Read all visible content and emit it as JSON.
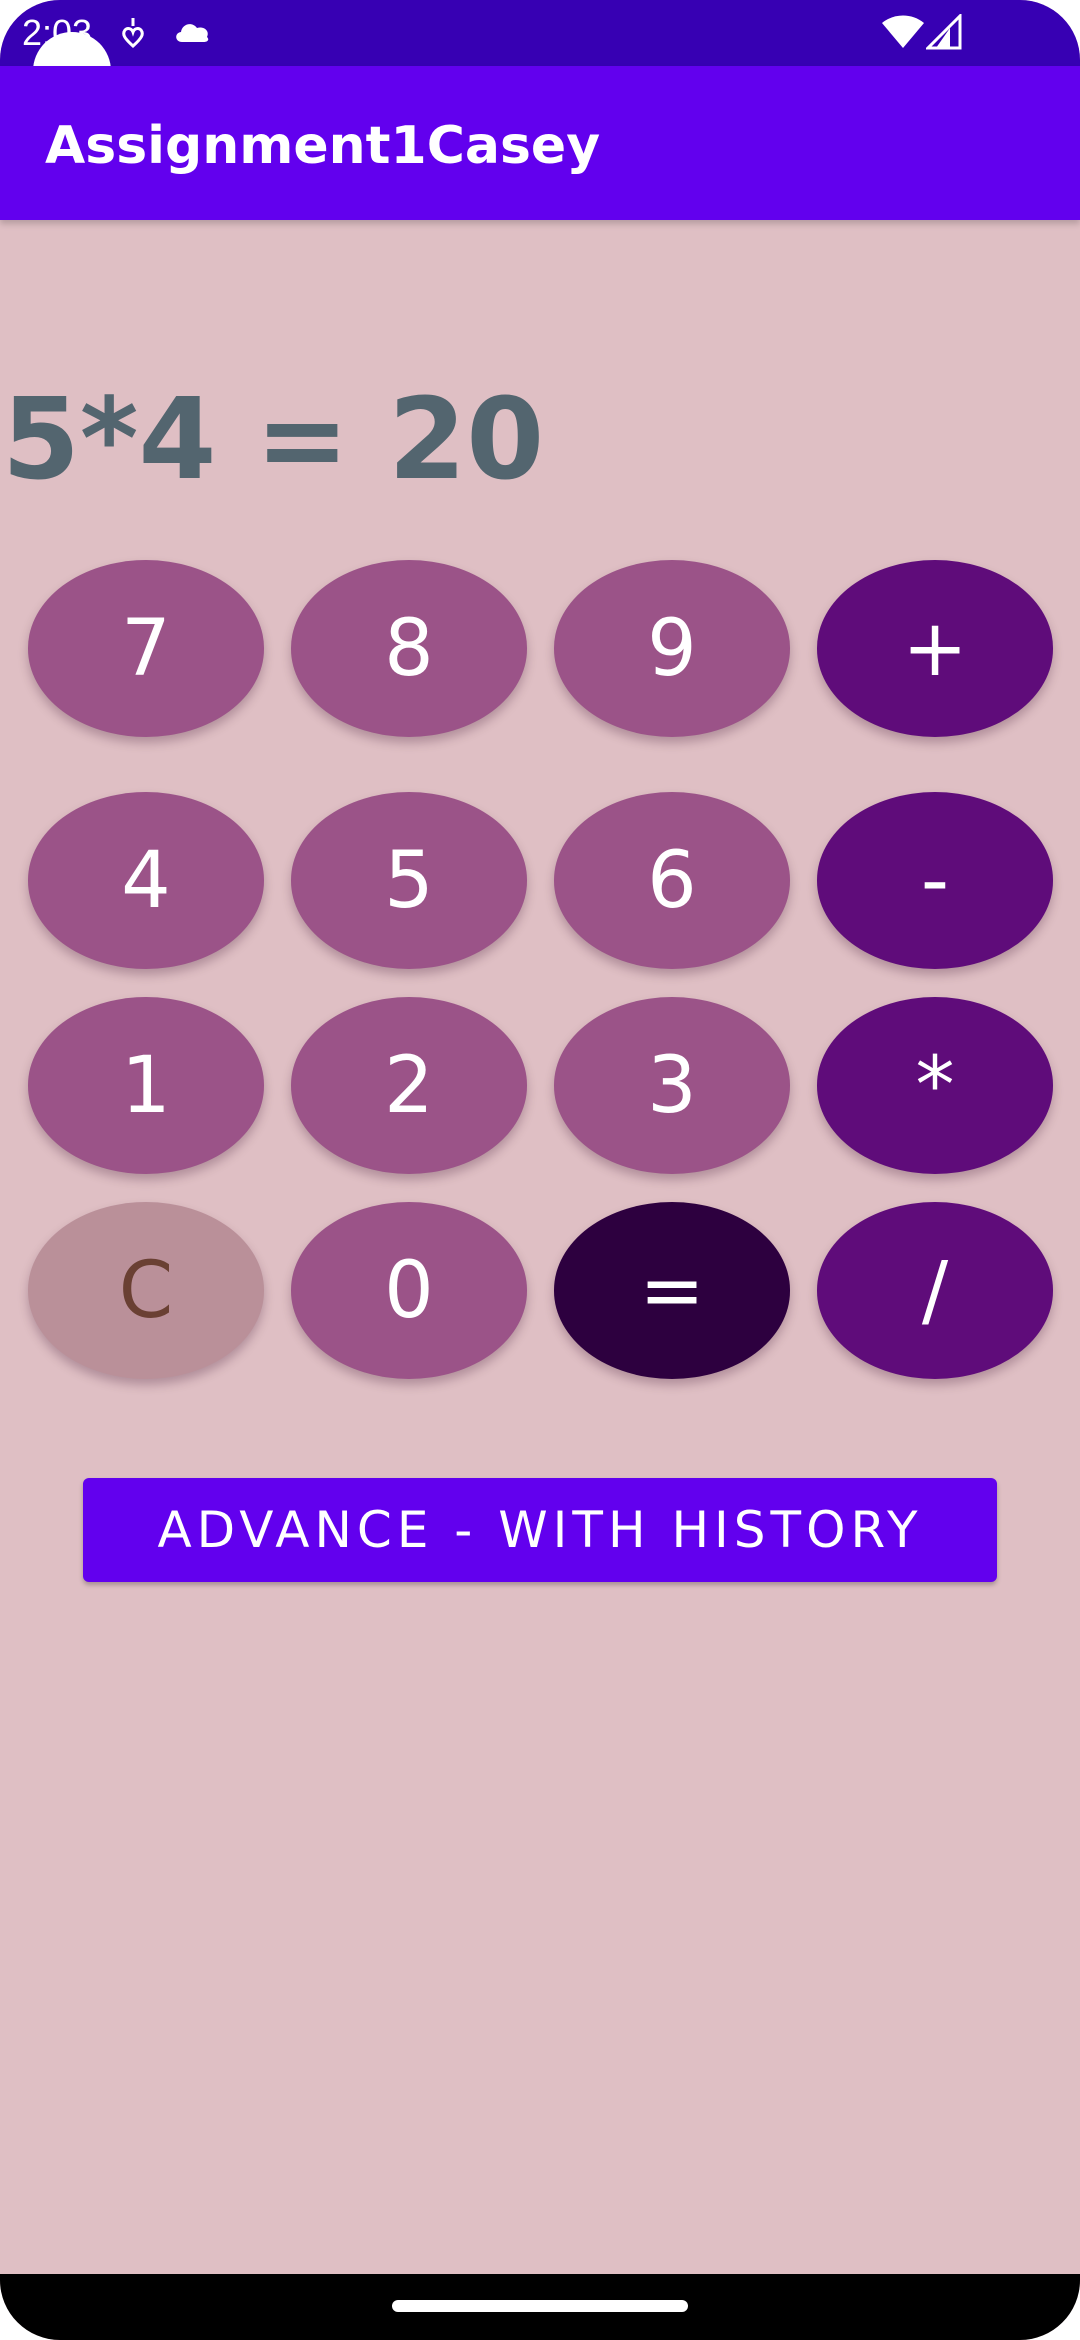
{
  "status_bar": {
    "time": "2:03",
    "icons": [
      "heart-stack-icon",
      "cloud-icon",
      "wifi-icon",
      "cell-signal-icon"
    ]
  },
  "app_bar": {
    "title": "Assignment1Casey"
  },
  "display": {
    "expression": "5*4 = 20"
  },
  "keypad": {
    "row1": [
      "7",
      "8",
      "9",
      "+"
    ],
    "row2": [
      "4",
      "5",
      "6",
      "-"
    ],
    "row3": [
      "1",
      "2",
      "3",
      "*"
    ],
    "row4": [
      "C",
      "0",
      "=",
      "/"
    ]
  },
  "advance_button": {
    "label": "ADVANCE - WITH HISTORY"
  },
  "colors": {
    "background": "#dfbfc4",
    "app_bar": "#6200ee",
    "status_bar": "#3700b3",
    "digit_key": "#9b5388",
    "operator_key": "#5f0c7a",
    "equals_key": "#2d003f",
    "clear_key": "#ba9099",
    "display_text": "#53656f"
  }
}
